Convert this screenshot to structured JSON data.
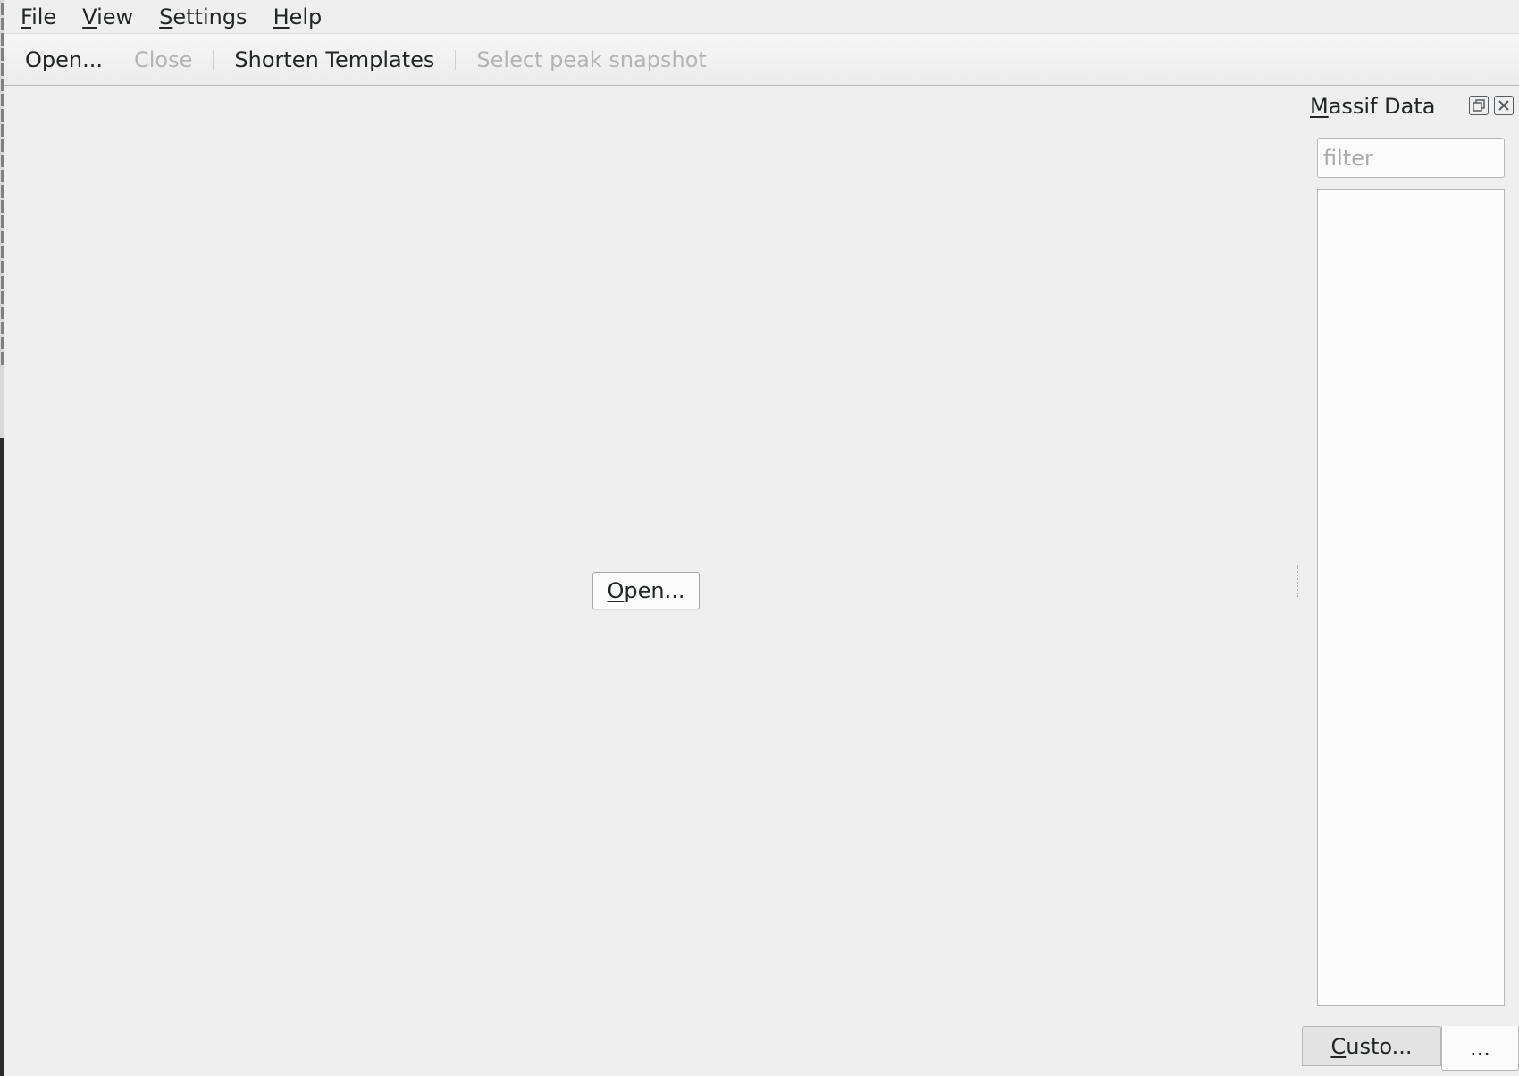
{
  "menubar": {
    "items": [
      {
        "label": "File",
        "mnemonic": "F",
        "rest": "ile"
      },
      {
        "label": "View",
        "mnemonic": "V",
        "rest": "iew"
      },
      {
        "label": "Settings",
        "mnemonic": "S",
        "rest": "ettings"
      },
      {
        "label": "Help",
        "mnemonic": "H",
        "rest": "elp"
      }
    ]
  },
  "toolbar": {
    "open_label": "Open...",
    "close_label": "Close",
    "shorten_label": "Shorten Templates",
    "peak_label": "Select peak snapshot"
  },
  "central": {
    "open_mnemonic": "O",
    "open_rest": "pen..."
  },
  "dock": {
    "title_mnemonic": "M",
    "title_rest": "assif Data",
    "filter_placeholder": "filter",
    "custom_mnemonic": "C",
    "custom_rest": "usto...",
    "more_label": "..."
  }
}
